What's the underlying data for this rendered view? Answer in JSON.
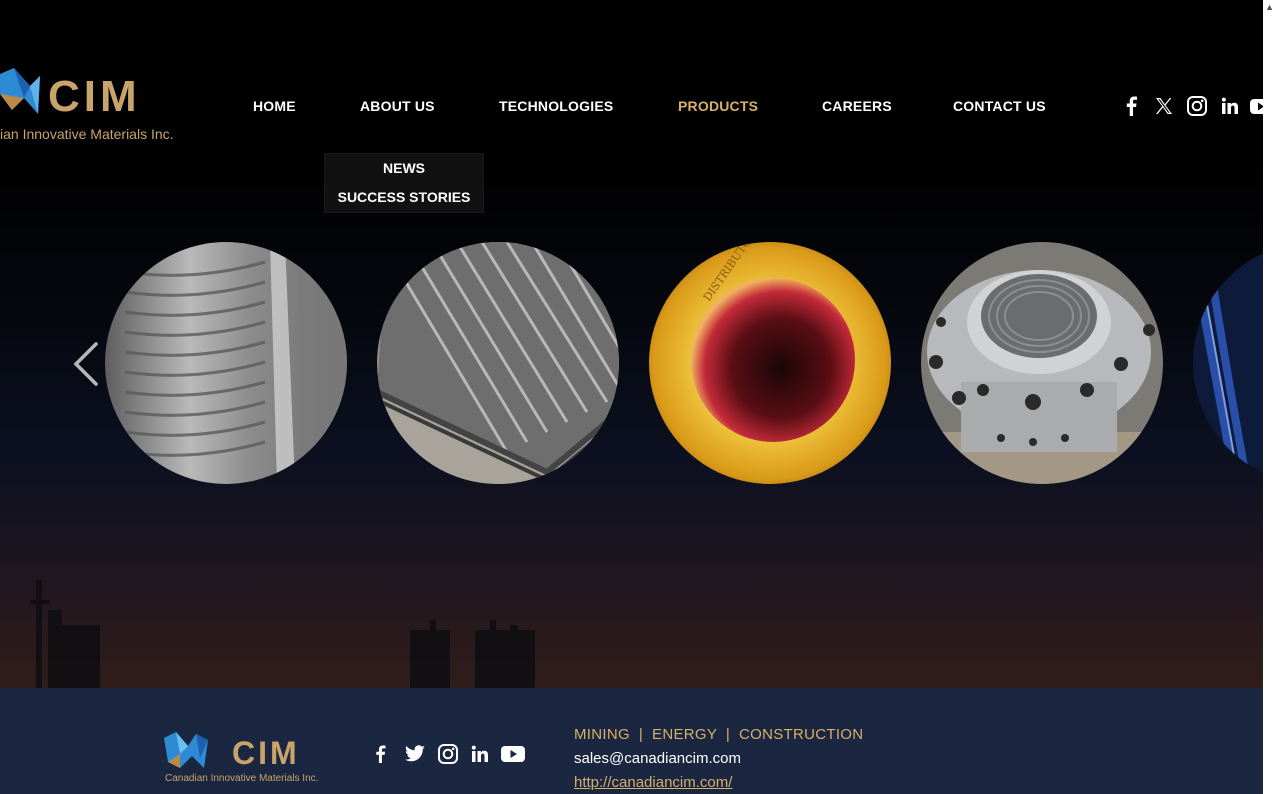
{
  "header": {
    "logo_wordmark": "CIM",
    "logo_tagline": "Canadian Innovative Materials Inc.",
    "logo_tagline_visible": "ian Innovative Materials Inc."
  },
  "nav": {
    "items": [
      {
        "label": "HOME"
      },
      {
        "label": "ABOUT US"
      },
      {
        "label": "TECHNOLOGIES"
      },
      {
        "label": "PRODUCTS",
        "active": true
      },
      {
        "label": "CAREERS"
      },
      {
        "label": "CONTACT US"
      }
    ]
  },
  "dropdown": {
    "items": [
      {
        "label": "NEWS"
      },
      {
        "label": "SUCCESS STORIES"
      }
    ]
  },
  "header_social": [
    "facebook-icon",
    "x-icon",
    "instagram-icon",
    "linkedin-icon",
    "youtube-icon"
  ],
  "carousel": {
    "items": [
      "welded-tube-panel",
      "clad-plate-stack",
      "bronze-distributor-nozzle",
      "steel-flange-fitting",
      "blue-pipe"
    ]
  },
  "footer": {
    "logo_wordmark": "CIM",
    "logo_tagline": "Canadian Innovative Materials Inc.",
    "social": [
      "facebook-icon",
      "twitter-icon",
      "instagram-icon",
      "linkedin-icon",
      "youtube-icon"
    ],
    "tagline": "MINING  |  ENERGY  |  CONSTRUCTION",
    "email": "sales@canadiancim.com",
    "url": "http://canadiancim.com/"
  },
  "colors": {
    "accent_gold": "#d7b06a",
    "logo_blue": "#2f8fd4",
    "footer_bg": "#1b2640"
  }
}
